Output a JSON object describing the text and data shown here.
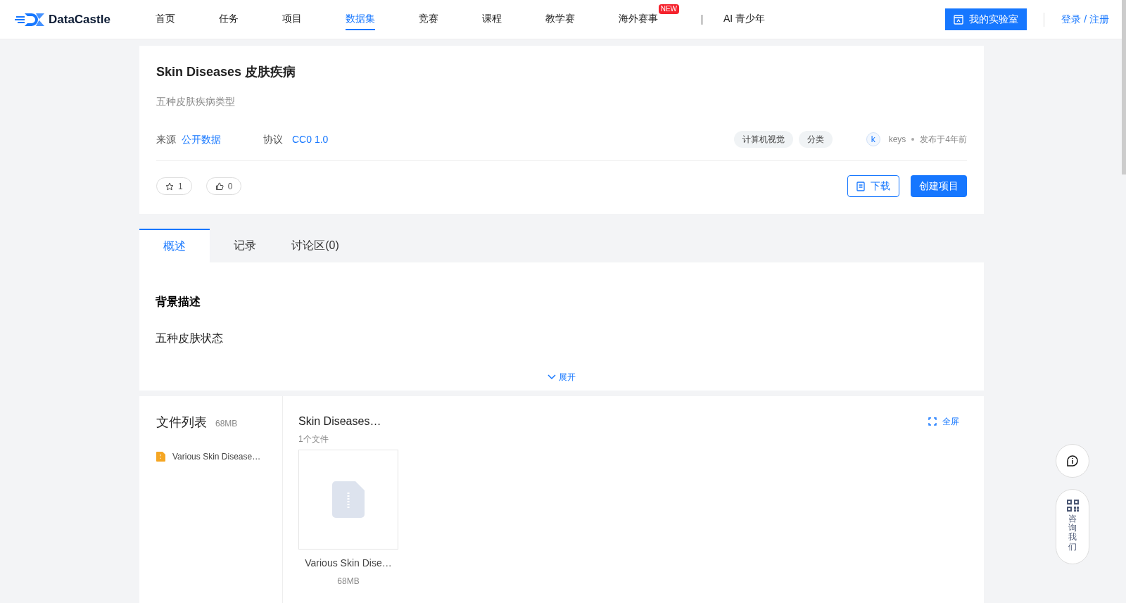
{
  "nav": {
    "logo": "DataCastle",
    "items": [
      {
        "label": "首页",
        "selected": false
      },
      {
        "label": "任务",
        "selected": false
      },
      {
        "label": "项目",
        "selected": false
      },
      {
        "label": "数据集",
        "selected": true
      },
      {
        "label": "竞赛",
        "selected": false
      },
      {
        "label": "课程",
        "selected": false
      },
      {
        "label": "教学赛",
        "selected": false
      },
      {
        "label": "海外赛事",
        "selected": false,
        "badge": "NEW"
      },
      {
        "label": "AI 青少年",
        "selected": false
      }
    ],
    "lab_button": "我的实验室",
    "login": "登录 / 注册"
  },
  "dataset": {
    "title": "Skin Diseases 皮肤疾病",
    "subtitle": "五种皮肤疾病类型",
    "source_label": "来源",
    "source": "公开数据",
    "license_label": "协议",
    "license": "CC0 1.0",
    "tags": [
      "计算机视觉",
      "分类"
    ],
    "avatar": "k",
    "author": "keys",
    "published": "发布于4年前",
    "stars": "1",
    "likes": "0",
    "download": "下载",
    "create": "创建项目"
  },
  "tabs": [
    {
      "label": "概述",
      "selected": true
    },
    {
      "label": "记录",
      "selected": false
    },
    {
      "label": "讨论区(0)",
      "selected": false
    }
  ],
  "overview": {
    "heading": "背景描述",
    "text": "五种皮肤状态",
    "expand": "展开"
  },
  "files": {
    "title": "文件列表",
    "size": "68MB",
    "tree": [
      {
        "name": "Various Skin Disease…"
      }
    ],
    "folder": "Skin Diseases…",
    "count": "1个文件",
    "fullscreen": "全屏",
    "items": [
      {
        "name": "Various Skin Dise…",
        "size": "68MB"
      }
    ]
  },
  "float": {
    "consult": "咨询我们"
  }
}
